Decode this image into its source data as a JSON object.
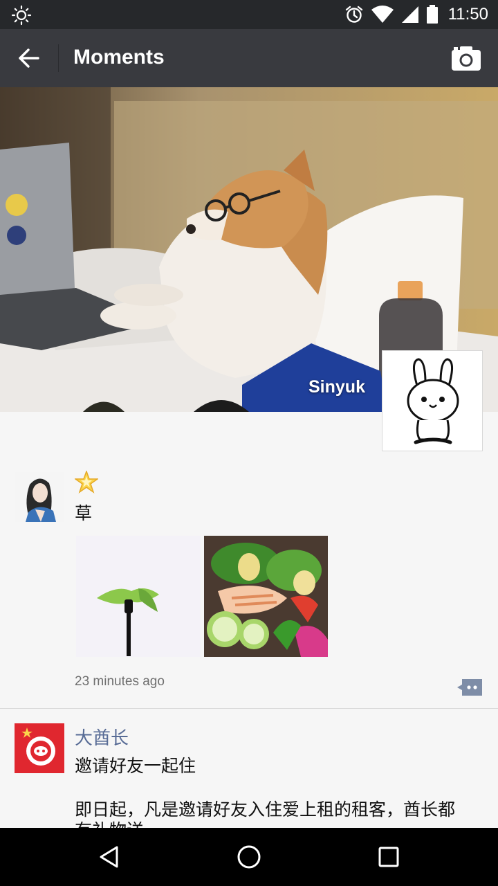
{
  "status_bar": {
    "time": "11:50"
  },
  "toolbar": {
    "title": "Moments"
  },
  "cover": {
    "name": "Sinyuk"
  },
  "posts": [
    {
      "text": "草",
      "time": "23 minutes ago"
    },
    {
      "author": "大酋长",
      "text_line1": "邀请好友一起住",
      "text_line2": "即日起，凡是邀请好友入住爱上租的租客，酋长都",
      "text_line3": "有礼物送~"
    }
  ],
  "colors": {
    "status_bar": "#26282b",
    "toolbar": "#393a3f",
    "author_link": "#576b95",
    "background": "#f6f6f6"
  },
  "icons": {
    "status_left": "brightness-icon",
    "alarm": "alarm-icon",
    "wifi": "wifi-icon",
    "signal": "signal-icon",
    "battery": "battery-icon",
    "back": "arrow-left-icon",
    "camera": "camera-icon",
    "comment": "comment-icon",
    "nav_back": "triangle-back-icon",
    "nav_home": "circle-home-icon",
    "nav_recent": "square-recent-icon"
  }
}
